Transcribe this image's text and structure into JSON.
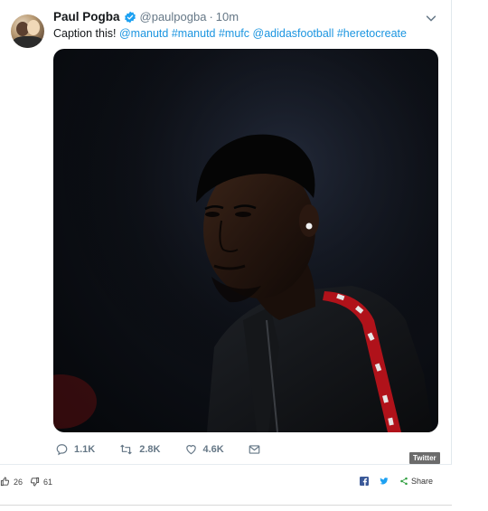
{
  "tweet": {
    "display_name": "Paul Pogba",
    "handle": "@paulpogba",
    "separator": "·",
    "time": "10m",
    "text_prefix": "Caption this!",
    "hashtags": [
      "@manutd",
      "#manutd",
      "#mufc",
      "@adidasfootball",
      "#heretocreate"
    ],
    "link_color": "#1b95e0",
    "verified_color": "#1da1f2"
  },
  "actions": {
    "replies": "1.1K",
    "retweets": "2.8K",
    "likes": "4.6K"
  },
  "badge": {
    "label": "Twitter"
  },
  "bottom_bar": {
    "upvotes": "26",
    "downvotes": "61",
    "share_label": "Share",
    "facebook_color": "#3b5998",
    "twitter_color": "#1da1f2",
    "share_color": "#2e9e3e"
  },
  "icons": {
    "verified": "verified-badge-icon",
    "chevron": "chevron-down-icon",
    "reply": "reply-icon",
    "retweet": "retweet-icon",
    "like": "heart-icon",
    "dm": "envelope-icon",
    "thumb_up": "thumb-up-icon",
    "thumb_down": "thumb-down-icon",
    "facebook": "facebook-icon",
    "twitter": "twitter-bird-icon",
    "share": "share-icon"
  }
}
